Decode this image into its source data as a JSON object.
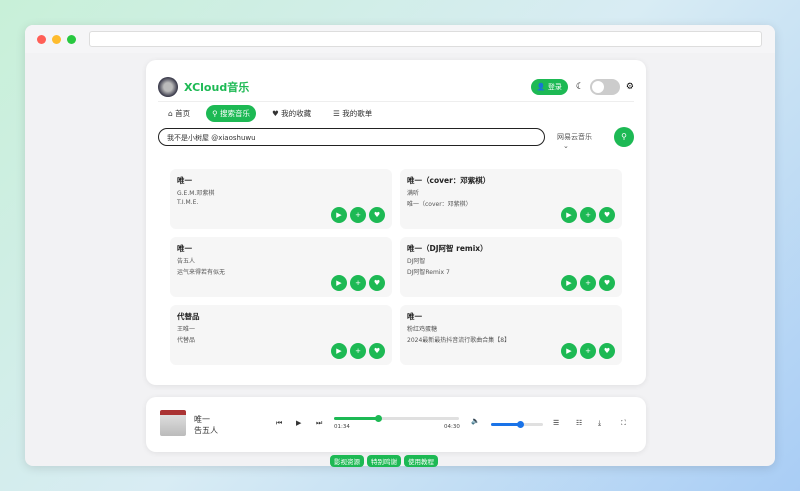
{
  "app": {
    "title": "XCloud音乐",
    "login": "登录",
    "accent": "#1db954"
  },
  "nav": [
    {
      "label": "首页",
      "icon": "home-icon"
    },
    {
      "label": "搜索音乐",
      "icon": "search-icon"
    },
    {
      "label": "我的收藏",
      "icon": "heart-icon"
    },
    {
      "label": "我的歌单",
      "icon": "list-icon"
    }
  ],
  "search": {
    "value": "我不是小树屋  @xiaoshuwu",
    "source": "网易云音乐"
  },
  "results": [
    {
      "name": "唯一",
      "artist": "G.E.M.邓紫棋",
      "album": "T.I.M.E."
    },
    {
      "name": "唯一（cover：邓紫棋）",
      "artist": "满听",
      "album": "唯一（cover：邓紫棋）"
    },
    {
      "name": "唯一",
      "artist": "告五人",
      "album": "运气来得若有似无"
    },
    {
      "name": "唯一（DJ阿智 remix）",
      "artist": "DJ阿智",
      "album": "DJ阿智Remix 7"
    },
    {
      "name": "代替品",
      "artist": "王唯一",
      "album": "代替品"
    },
    {
      "name": "唯一",
      "artist": "粉红鸡蛋糖",
      "album": "2024最新最热抖音流行歌曲合集【8】"
    }
  ],
  "player": {
    "title": "唯一",
    "artist": "告五人",
    "current": "01:34",
    "duration": "04:30",
    "progress": 0.35,
    "volume": 0.55,
    "volume_color": "#1a73e8"
  },
  "footer": [
    "影视资源",
    "特别鸣谢",
    "使用教程"
  ]
}
